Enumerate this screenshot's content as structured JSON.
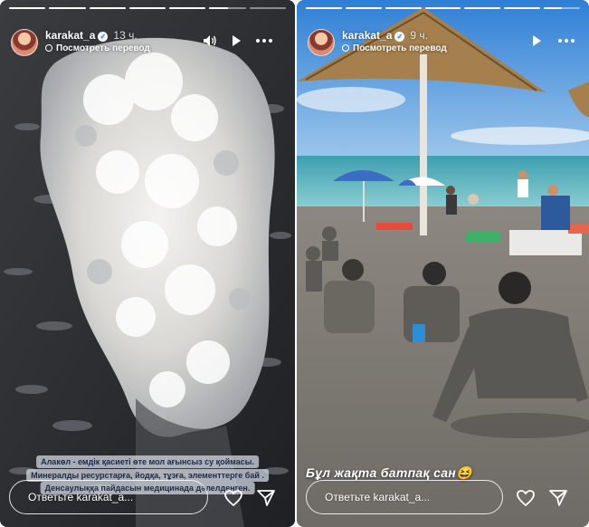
{
  "stories": [
    {
      "username": "karakat_a",
      "time": "13 ч.",
      "translate": "Посмотреть перевод",
      "captions": [
        "Алакөл - емдік қасиеті өте мол ағынсыз су қоймасы.",
        "Минералды ресурстарға, йодқа, тұзға, элементтерге бай .",
        "Денсаулыққа пайдасын медицинада дәлелденген."
      ],
      "reply_placeholder": "Ответьте karakat_a...",
      "progress": [
        1,
        1,
        1,
        1,
        1,
        0.5,
        0
      ]
    },
    {
      "username": "karakat_a",
      "time": "9 ч.",
      "translate": "Посмотреть перевод",
      "overlay_text": "Бұл жақта батпақ сан😆",
      "reply_placeholder": "Ответьте karakat_a...",
      "progress": [
        1,
        1,
        1,
        1,
        1,
        1,
        0.5
      ]
    }
  ],
  "icons": {
    "verified": "verified-badge-icon",
    "sound": "speaker-icon",
    "play": "play-icon",
    "more": "more-horizontal-icon",
    "like": "heart-icon",
    "share": "send-icon"
  }
}
